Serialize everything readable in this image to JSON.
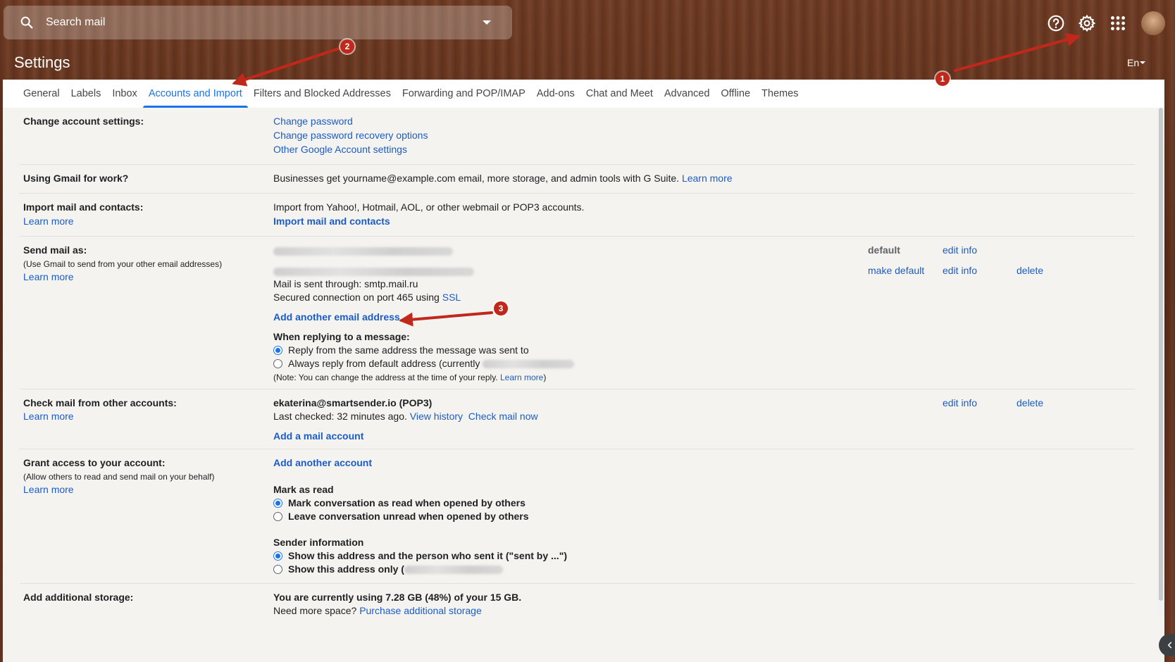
{
  "search": {
    "placeholder": "Search mail"
  },
  "header": {
    "title": "Settings",
    "lang": "En"
  },
  "tabs": [
    {
      "label": "General"
    },
    {
      "label": "Labels"
    },
    {
      "label": "Inbox"
    },
    {
      "label": "Accounts and Import",
      "active": true
    },
    {
      "label": "Filters and Blocked Addresses"
    },
    {
      "label": "Forwarding and POP/IMAP"
    },
    {
      "label": "Add-ons"
    },
    {
      "label": "Chat and Meet"
    },
    {
      "label": "Advanced"
    },
    {
      "label": "Offline"
    },
    {
      "label": "Themes"
    }
  ],
  "change_account": {
    "label": "Change account settings:",
    "links": [
      "Change password",
      "Change password recovery options",
      "Other Google Account settings"
    ]
  },
  "gmail_work": {
    "label": "Using Gmail for work?",
    "text": "Businesses get yourname@example.com email, more storage, and admin tools with G Suite.",
    "learn_more": "Learn more"
  },
  "import": {
    "label": "Import mail and contacts:",
    "learn_more": "Learn more",
    "text": "Import from Yahoo!, Hotmail, AOL, or other webmail or POP3 accounts.",
    "action": "Import mail and contacts"
  },
  "send_as": {
    "label": "Send mail as:",
    "sub": "(Use Gmail to send from your other email addresses)",
    "learn_more": "Learn more",
    "default_label": "default",
    "edit_info": "edit info",
    "make_default": "make default",
    "delete": "delete",
    "sent_through": "Mail is sent through: smtp.mail.ru",
    "secured": "Secured connection on port 465 using",
    "ssl": "SSL",
    "add_address": "Add another email address",
    "reply_heading": "When replying to a message:",
    "reply_same": "Reply from the same address the message was sent to",
    "reply_default": "Always reply from default address (currently",
    "note_prefix": "(Note: You can change the address at the time of your reply.",
    "note_learn": "Learn more",
    "note_suffix": ")"
  },
  "check_mail": {
    "label": "Check mail from other accounts:",
    "learn_more": "Learn more",
    "account": "ekaterina@smartsender.io (POP3)",
    "last_checked": "Last checked: 32 minutes ago.",
    "view_history": "View history",
    "check_now": "Check mail now",
    "add_account": "Add a mail account",
    "edit_info": "edit info",
    "delete": "delete"
  },
  "grant": {
    "label": "Grant access to your account:",
    "sub": "(Allow others to read and send mail on your behalf)",
    "learn_more": "Learn more",
    "add_account": "Add another account",
    "mark_heading": "Mark as read",
    "mark_opened": "Mark conversation as read when opened by others",
    "leave_unread": "Leave conversation unread when opened by others",
    "sender_heading": "Sender information",
    "show_both": "Show this address and the person who sent it (\"sent by ...\")",
    "show_only": "Show this address only ("
  },
  "storage": {
    "label": "Add additional storage:",
    "usage": "You are currently using 7.28 GB (48%) of your 15 GB.",
    "need_more": "Need more space?",
    "purchase": "Purchase additional storage"
  },
  "annotations": [
    "1",
    "2",
    "3"
  ],
  "colors": {
    "link": "#1a5cc8",
    "active_tab": "#1a73e8",
    "marker": "#c0281c"
  }
}
